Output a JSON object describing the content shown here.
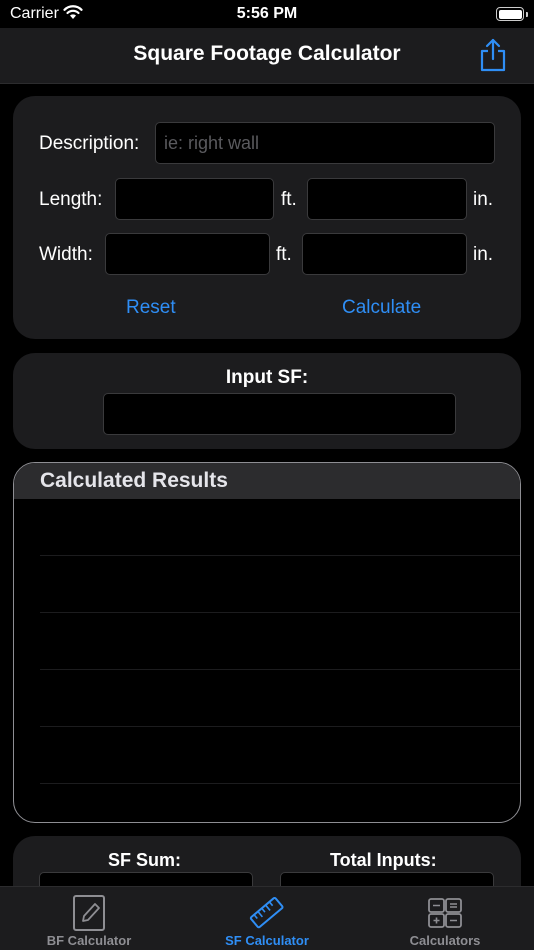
{
  "status_bar": {
    "carrier": "Carrier",
    "time": "5:56 PM"
  },
  "nav": {
    "title": "Square Footage Calculator"
  },
  "form": {
    "description_label": "Description:",
    "description_placeholder": "ie: right wall",
    "description_value": "",
    "length_label": "Length:",
    "width_label": "Width:",
    "ft_unit": "ft.",
    "in_unit": "in.",
    "length_ft_value": "",
    "length_in_value": "",
    "width_ft_value": "",
    "width_in_value": "",
    "reset_label": "Reset",
    "calculate_label": "Calculate"
  },
  "input_sf": {
    "label": "Input SF:",
    "value": ""
  },
  "results": {
    "title": "Calculated Results",
    "rows": [
      "",
      "",
      "",
      "",
      "",
      ""
    ]
  },
  "summary": {
    "sf_sum_label": "SF Sum:",
    "total_inputs_label": "Total Inputs:"
  },
  "tabs": [
    {
      "label": "BF Calculator",
      "icon": "pencil-square-icon",
      "active": false
    },
    {
      "label": "SF Calculator",
      "icon": "ruler-icon",
      "active": true
    },
    {
      "label": "Calculators",
      "icon": "calculator-icon",
      "active": false
    }
  ],
  "colors": {
    "accent": "#2f8ef5",
    "card": "#1c1c1e",
    "background": "#000000"
  }
}
